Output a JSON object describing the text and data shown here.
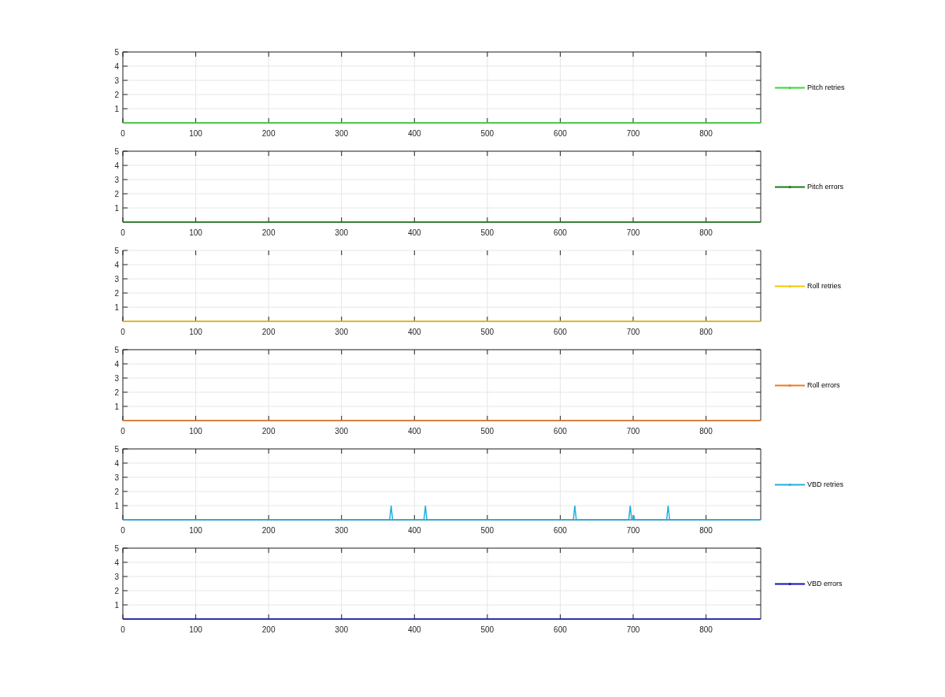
{
  "panels": [
    {
      "top_border": true,
      "chart_data": {
        "type": "line",
        "grid": true,
        "x": [
          0,
          875
        ],
        "xlim": [
          0,
          875
        ],
        "ylim": [
          0,
          5
        ],
        "xticks": [
          0,
          100,
          200,
          300,
          400,
          500,
          600,
          700,
          800
        ],
        "yticks": [
          1,
          2,
          3,
          4,
          5
        ],
        "series": [
          {
            "name": "Pitch retries",
            "color": "#33dd33",
            "values": [
              0,
              0
            ]
          }
        ]
      }
    },
    {
      "top_border": true,
      "chart_data": {
        "type": "line",
        "grid": true,
        "x": [
          0,
          875
        ],
        "xlim": [
          0,
          875
        ],
        "ylim": [
          0,
          5
        ],
        "xticks": [
          0,
          100,
          200,
          300,
          400,
          500,
          600,
          700,
          800
        ],
        "yticks": [
          1,
          2,
          3,
          4,
          5
        ],
        "series": [
          {
            "name": "Pitch errors",
            "color": "#1a7a1a",
            "values": [
              0,
              0
            ]
          }
        ]
      }
    },
    {
      "top_border": false,
      "chart_data": {
        "type": "line",
        "grid": true,
        "x": [
          0,
          875
        ],
        "xlim": [
          0,
          875
        ],
        "ylim": [
          0,
          5
        ],
        "xticks": [
          0,
          100,
          200,
          300,
          400,
          500,
          600,
          700,
          800
        ],
        "yticks": [
          1,
          2,
          3,
          4,
          5
        ],
        "series": [
          {
            "name": "Roll retries",
            "color": "#f2c800",
            "values": [
              0,
              0
            ]
          }
        ]
      }
    },
    {
      "top_border": true,
      "chart_data": {
        "type": "line",
        "grid": true,
        "x": [
          0,
          875
        ],
        "xlim": [
          0,
          875
        ],
        "ylim": [
          0,
          5
        ],
        "xticks": [
          0,
          100,
          200,
          300,
          400,
          500,
          600,
          700,
          800
        ],
        "yticks": [
          1,
          2,
          3,
          4,
          5
        ],
        "series": [
          {
            "name": "Roll errors",
            "color": "#ee7a22",
            "values": [
              0,
              0
            ]
          }
        ]
      }
    },
    {
      "top_border": true,
      "chart_data": {
        "type": "line",
        "grid": true,
        "x": [
          0,
          366,
          368,
          370,
          413,
          415,
          417,
          618,
          620,
          622,
          694,
          696,
          698,
          700,
          701,
          702,
          746,
          748,
          750,
          875
        ],
        "xlim": [
          0,
          875
        ],
        "ylim": [
          0,
          5
        ],
        "xticks": [
          0,
          100,
          200,
          300,
          400,
          500,
          600,
          700,
          800
        ],
        "yticks": [
          1,
          2,
          3,
          4,
          5
        ],
        "series": [
          {
            "name": "VBD retries",
            "color": "#1eb0e0",
            "values": [
              0,
              0,
              1,
              0,
              0,
              1,
              0,
              0,
              1,
              0,
              0,
              1,
              0,
              0,
              0.3,
              0,
              0,
              1,
              0,
              0
            ]
          }
        ]
      }
    },
    {
      "top_border": true,
      "chart_data": {
        "type": "line",
        "grid": true,
        "x": [
          0,
          875
        ],
        "xlim": [
          0,
          875
        ],
        "ylim": [
          0,
          5
        ],
        "xticks": [
          0,
          100,
          200,
          300,
          400,
          500,
          600,
          700,
          800
        ],
        "yticks": [
          1,
          2,
          3,
          4,
          5
        ],
        "series": [
          {
            "name": "VBD errors",
            "color": "#1212b0",
            "values": [
              0,
              0
            ]
          }
        ]
      }
    }
  ]
}
